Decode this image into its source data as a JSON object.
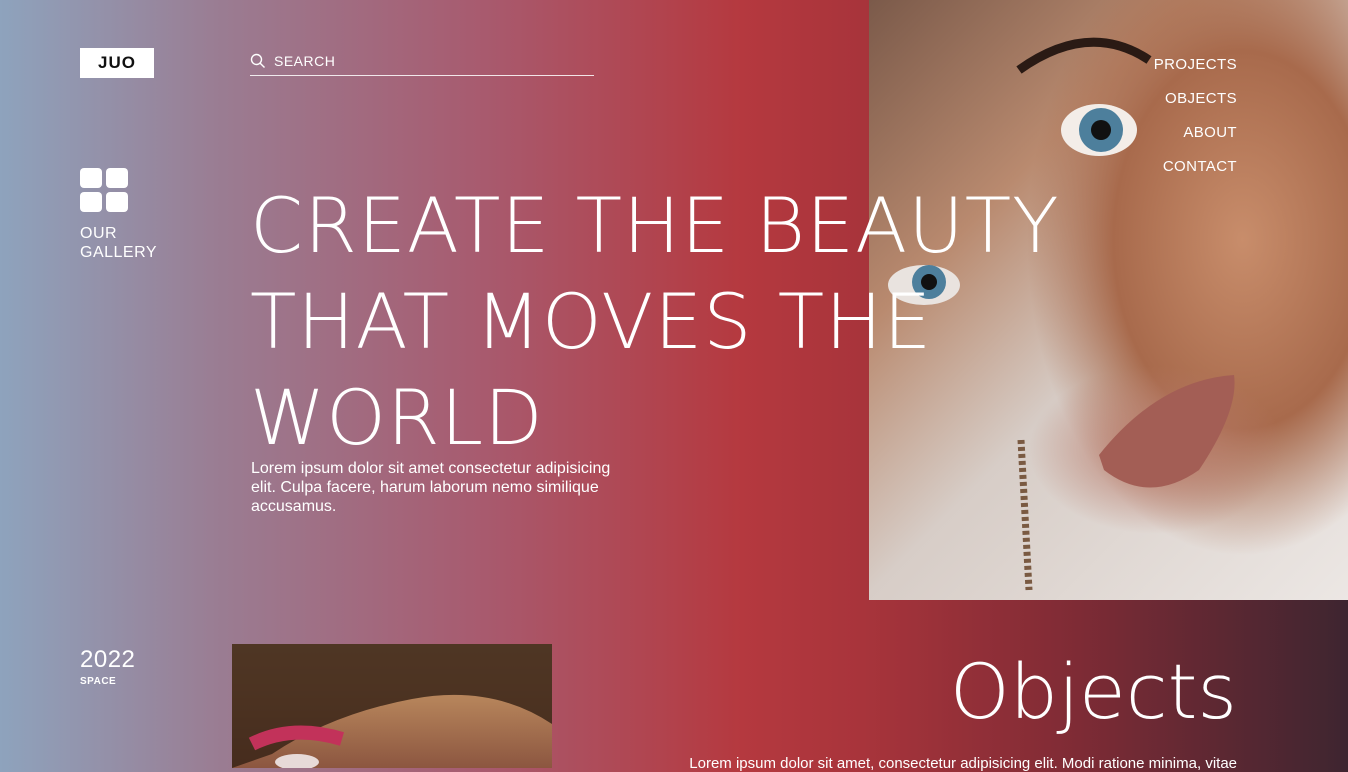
{
  "brand": {
    "logo_text": "JUO"
  },
  "search": {
    "placeholder": "SEARCH"
  },
  "gallery": {
    "label": "OUR\nGALLERY"
  },
  "nav": {
    "items": [
      "PROJECTS",
      "OBJECTS",
      "ABOUT",
      "CONTACT"
    ]
  },
  "hero": {
    "headline_lines": [
      "CREATE THE BEAUTY",
      "THAT MOVES THE",
      "WORLD"
    ],
    "text": "Lorem ipsum dolor sit amet consectetur adipisicing elit. Culpa facere, harum laborum nemo similique accusamus."
  },
  "year": {
    "value": "2022",
    "label": "SPACE"
  },
  "objects": {
    "title": "Objects",
    "text": "Lorem ipsum dolor sit amet, consectetur adipisicing elit. Modi ratione minima, vitae"
  },
  "colors": {
    "accent": "#b5393f",
    "left": "#8ea3bd",
    "right": "#3e2530"
  },
  "icons": [
    "search-icon",
    "gallery-grid-icon"
  ]
}
